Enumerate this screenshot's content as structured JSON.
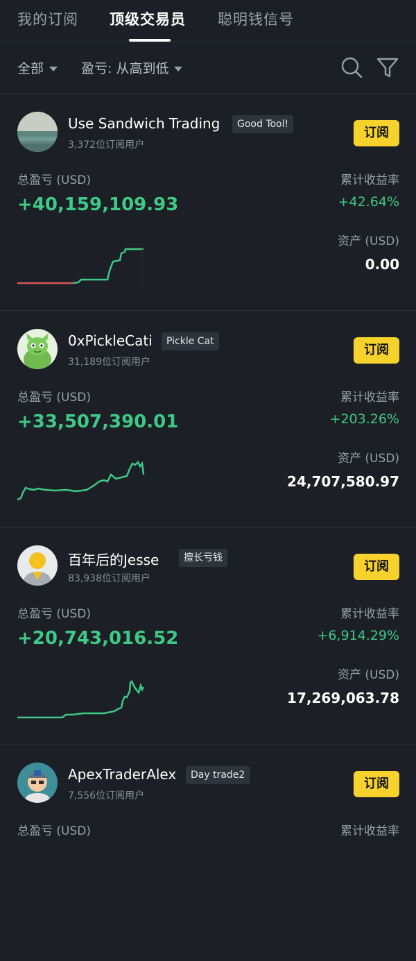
{
  "tabs": [
    {
      "label": "我的订阅"
    },
    {
      "label": "顶级交易员"
    },
    {
      "label": "聪明钱信号"
    }
  ],
  "filters": {
    "category": "全部",
    "sort": "盈亏: 从高到低"
  },
  "colors": {
    "background": "#1c1f26",
    "accent_yellow": "#f7d22c",
    "profit_green": "#3ec985",
    "loss_red": "#e0555a"
  },
  "labels": {
    "total_pnl": "总盈亏 (USD)",
    "cumulative_return": "累计收益率",
    "assets": "资产 (USD)",
    "subscribe": "订阅"
  },
  "traders": [
    {
      "name": "Use Sandwich Trading",
      "tag": "Good Tool!",
      "subscribers": "3,372位订阅用户",
      "total_pnl": "+40,159,109.93",
      "cumulative_return": "+42.64%",
      "assets": "0.00",
      "avatar": "ocean-photo"
    },
    {
      "name": "0xPickleCati",
      "tag": "Pickle Cat",
      "subscribers": "31,189位订阅用户",
      "total_pnl": "+33,507,390.01",
      "cumulative_return": "+203.26%",
      "assets": "24,707,580.97",
      "avatar": "green-cat-cartoon"
    },
    {
      "name": "百年后的Jesse",
      "tag": "擅长亏钱",
      "subscribers": "83,938位订阅用户",
      "total_pnl": "+20,743,016.52",
      "cumulative_return": "+6,914.29%",
      "assets": "17,269,063.78",
      "avatar": "default-user-yellow"
    },
    {
      "name": "ApexTraderAlex",
      "tag": "Day trade2",
      "subscribers": "7,556位订阅用户",
      "total_pnl": "",
      "cumulative_return": "",
      "assets": "",
      "avatar": "cartoon-man-cap"
    }
  ]
}
